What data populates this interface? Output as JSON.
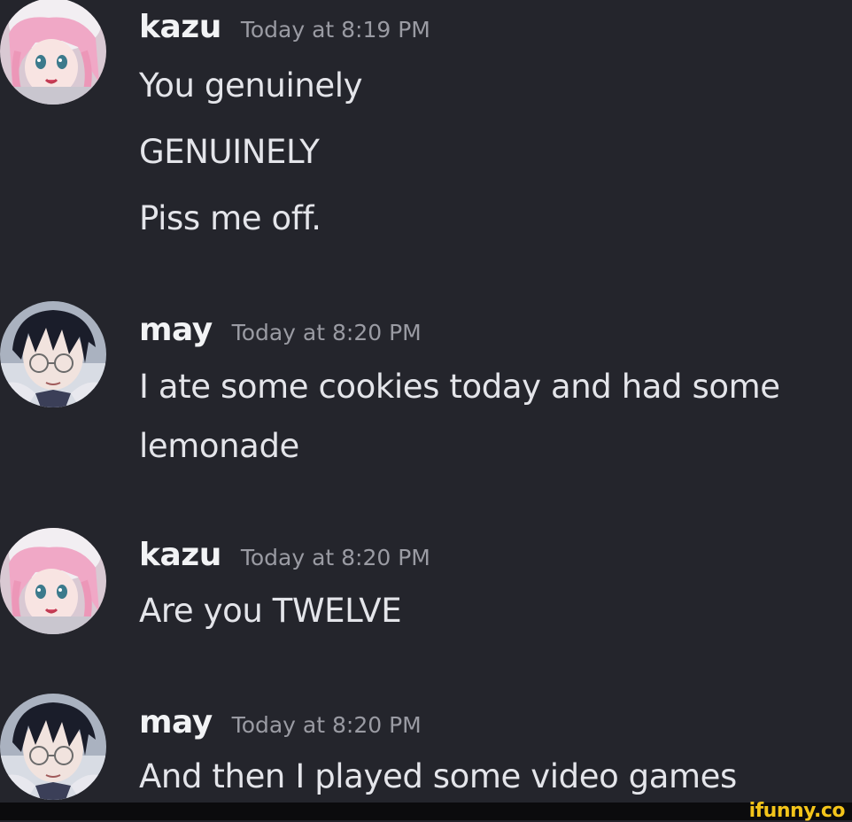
{
  "messages": [
    {
      "username": "kazu",
      "timestamp": "Today at 8:19 PM",
      "avatar": "pink-hair-anime-girl",
      "lines": [
        "You genuinely",
        "GENUINELY",
        "Piss me off."
      ]
    },
    {
      "username": "may",
      "timestamp": "Today at 8:20 PM",
      "avatar": "dark-hair-glasses-anime-boy",
      "lines": [
        "I ate some cookies today and had some",
        "lemonade"
      ]
    },
    {
      "username": "kazu",
      "timestamp": "Today at 8:20 PM",
      "avatar": "pink-hair-anime-girl",
      "lines": [
        "Are you TWELVE"
      ]
    },
    {
      "username": "may",
      "timestamp": "Today at 8:20 PM",
      "avatar": "dark-hair-glasses-anime-boy",
      "lines": [
        "And then I played some video games"
      ]
    }
  ],
  "watermark": "ifunny.co",
  "colors": {
    "background": "#24252c",
    "username": "#f2f3f5",
    "timestamp": "#9a9ba3",
    "message_text": "#e4e5ea",
    "watermark": "#f3c41a"
  }
}
